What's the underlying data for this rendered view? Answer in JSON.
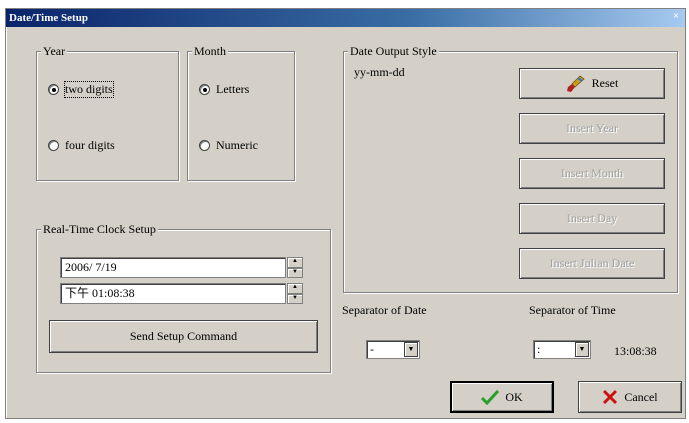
{
  "window": {
    "title": "Date/Time Setup",
    "close_glyph": "×"
  },
  "year": {
    "legend": "Year",
    "options": [
      "two digits",
      "four digits"
    ],
    "selected": "two digits"
  },
  "month": {
    "legend": "Month",
    "options": [
      "Letters",
      "Numeric"
    ],
    "selected": "Letters"
  },
  "output": {
    "legend": "Date Output Style",
    "format": "yy-mm-dd",
    "buttons": {
      "reset": "Reset",
      "insert_year": "Insert Year",
      "insert_month": "Insert Month",
      "insert_day": "Insert Day",
      "insert_julian": "Insert Julian Date"
    }
  },
  "clock": {
    "legend": "Real-Time Clock Setup",
    "date_value": "2006/ 7/19",
    "time_value": "下午 01:08:38",
    "send_button": "Send Setup Command"
  },
  "separators": {
    "date_label": "Separator of Date",
    "date_value": "-",
    "time_label": "Separator of Time",
    "time_value": ":",
    "time_preview": "13:08:38"
  },
  "footer": {
    "ok": "OK",
    "cancel": "Cancel"
  },
  "colors": {
    "title_bar": "#0a246a",
    "ok_check": "#2a9d2a",
    "cancel_x": "#cc1111"
  }
}
